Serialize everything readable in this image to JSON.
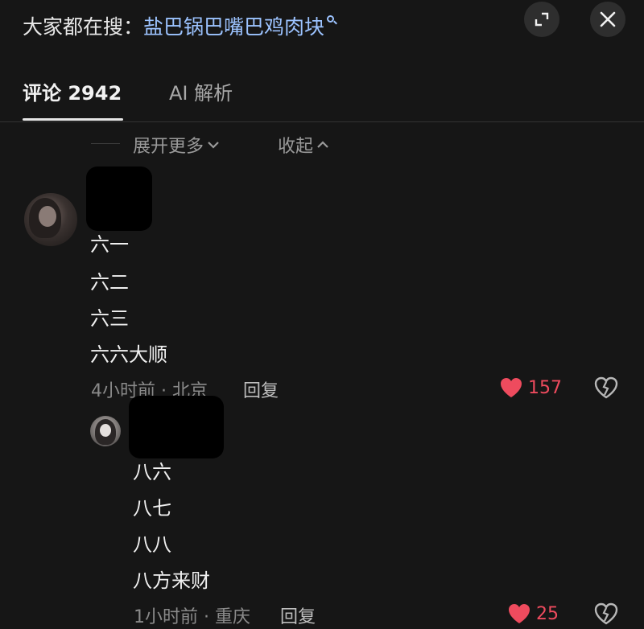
{
  "search": {
    "prefix": "大家都在搜：",
    "query": "盐巴锅巴嘴巴鸡肉块"
  },
  "tabs": [
    {
      "label": "评论 2942"
    },
    {
      "label": "AI 解析"
    }
  ],
  "expand": {
    "more_label": "展开更多",
    "collapse_label": "收起"
  },
  "comment": {
    "lines": [
      "六一",
      "六二",
      "六三",
      "六六大顺"
    ],
    "meta": "4小时前 · 北京",
    "reply_label": "回复",
    "likes": "157"
  },
  "reply": {
    "lines": [
      "八六",
      "八七",
      "八八",
      "八方来财"
    ],
    "meta": "1小时前 · 重庆",
    "reply_label": "回复",
    "likes": "25"
  },
  "colors": {
    "background": "#161616",
    "link": "#9cc3ff",
    "like": "#ee4b5e"
  },
  "icons": [
    "search-icon",
    "expand-icon",
    "close-icon",
    "chevron-down-icon",
    "chevron-up-icon",
    "heart-icon",
    "broken-heart-icon"
  ]
}
